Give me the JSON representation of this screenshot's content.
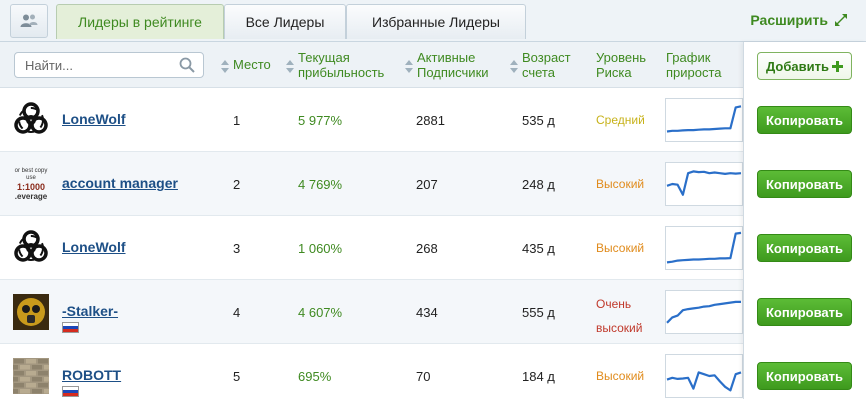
{
  "tabs": {
    "active": "Лидеры в рейтинге",
    "all": "Все Лидеры",
    "favorites": "Избранные Лидеры",
    "expand": "Расширить"
  },
  "search": {
    "placeholder": "Найти..."
  },
  "columns": {
    "place": "Место",
    "profit_1": "Текущая",
    "profit_2": "прибыльность",
    "subs_1": "Активные",
    "subs_2": "Подписчики",
    "age_1": "Возраст",
    "age_2": "счета",
    "risk_1": "Уровень",
    "risk_2": "Риска",
    "chart_1": "График",
    "chart_2": "прироста"
  },
  "add_button": "Добавить",
  "copy_label": "Копировать",
  "colors": {
    "accent_green": "#3f8a21",
    "link_blue": "#1d4f86",
    "risk_medium": "#c7b21a",
    "risk_high": "#e08b1c",
    "risk_very_high": "#c0392b",
    "sparkline": "#2a6fc9"
  },
  "rows": [
    {
      "name": "LoneWolf",
      "avatar": "biohazard-icon",
      "flag": null,
      "place": "1",
      "profit": "5 977%",
      "subs": "2881",
      "age": "535 д",
      "risk_1": "Средний",
      "risk_2": "",
      "risk_level": "medium",
      "growth": [
        0.18,
        0.2,
        0.2,
        0.21,
        0.22,
        0.22,
        0.23,
        0.24,
        0.24,
        0.25,
        0.26,
        0.27,
        0.27,
        0.85,
        0.88
      ]
    },
    {
      "name": "account manager",
      "avatar": "leverage-text-logo",
      "flag": null,
      "avatar_text_1": "or best copy",
      "avatar_text_2": "use",
      "avatar_text_3": "1:1000",
      "avatar_text_4": ".everage",
      "place": "2",
      "profit": "4 769%",
      "subs": "207",
      "age": "248 д",
      "risk_1": "Высокий",
      "risk_2": "",
      "risk_level": "high",
      "growth": [
        0.45,
        0.5,
        0.48,
        0.2,
        0.8,
        0.85,
        0.83,
        0.84,
        0.8,
        0.82,
        0.8,
        0.78,
        0.8,
        0.79,
        0.8
      ]
    },
    {
      "name": "LoneWolf",
      "avatar": "biohazard-icon",
      "flag": null,
      "place": "3",
      "profit": "1 060%",
      "subs": "268",
      "age": "435 д",
      "risk_1": "Высокий",
      "risk_2": "",
      "risk_level": "high",
      "growth": [
        0.1,
        0.12,
        0.15,
        0.16,
        0.17,
        0.18,
        0.18,
        0.19,
        0.2,
        0.2,
        0.21,
        0.21,
        0.22,
        0.9,
        0.92
      ]
    },
    {
      "name": "-Stalker-",
      "avatar": "stalker-gasmask-icon",
      "flag": "ru",
      "place": "4",
      "profit": "4 607%",
      "subs": "434",
      "age": "555 д",
      "risk_1": "Очень",
      "risk_2": "высокий",
      "risk_level": "very_high",
      "growth": [
        0.2,
        0.35,
        0.4,
        0.55,
        0.58,
        0.6,
        0.62,
        0.65,
        0.66,
        0.7,
        0.72,
        0.74,
        0.76,
        0.78,
        0.78
      ]
    },
    {
      "name": "ROBOTT",
      "avatar": "brick-wall-icon",
      "flag": "ru",
      "place": "5",
      "profit": "695%",
      "subs": "70",
      "age": "184 д",
      "risk_1": "Высокий",
      "risk_2": "",
      "risk_level": "high",
      "growth": [
        0.4,
        0.45,
        0.42,
        0.43,
        0.45,
        0.15,
        0.6,
        0.55,
        0.5,
        0.52,
        0.35,
        0.2,
        0.1,
        0.55,
        0.6
      ]
    }
  ]
}
